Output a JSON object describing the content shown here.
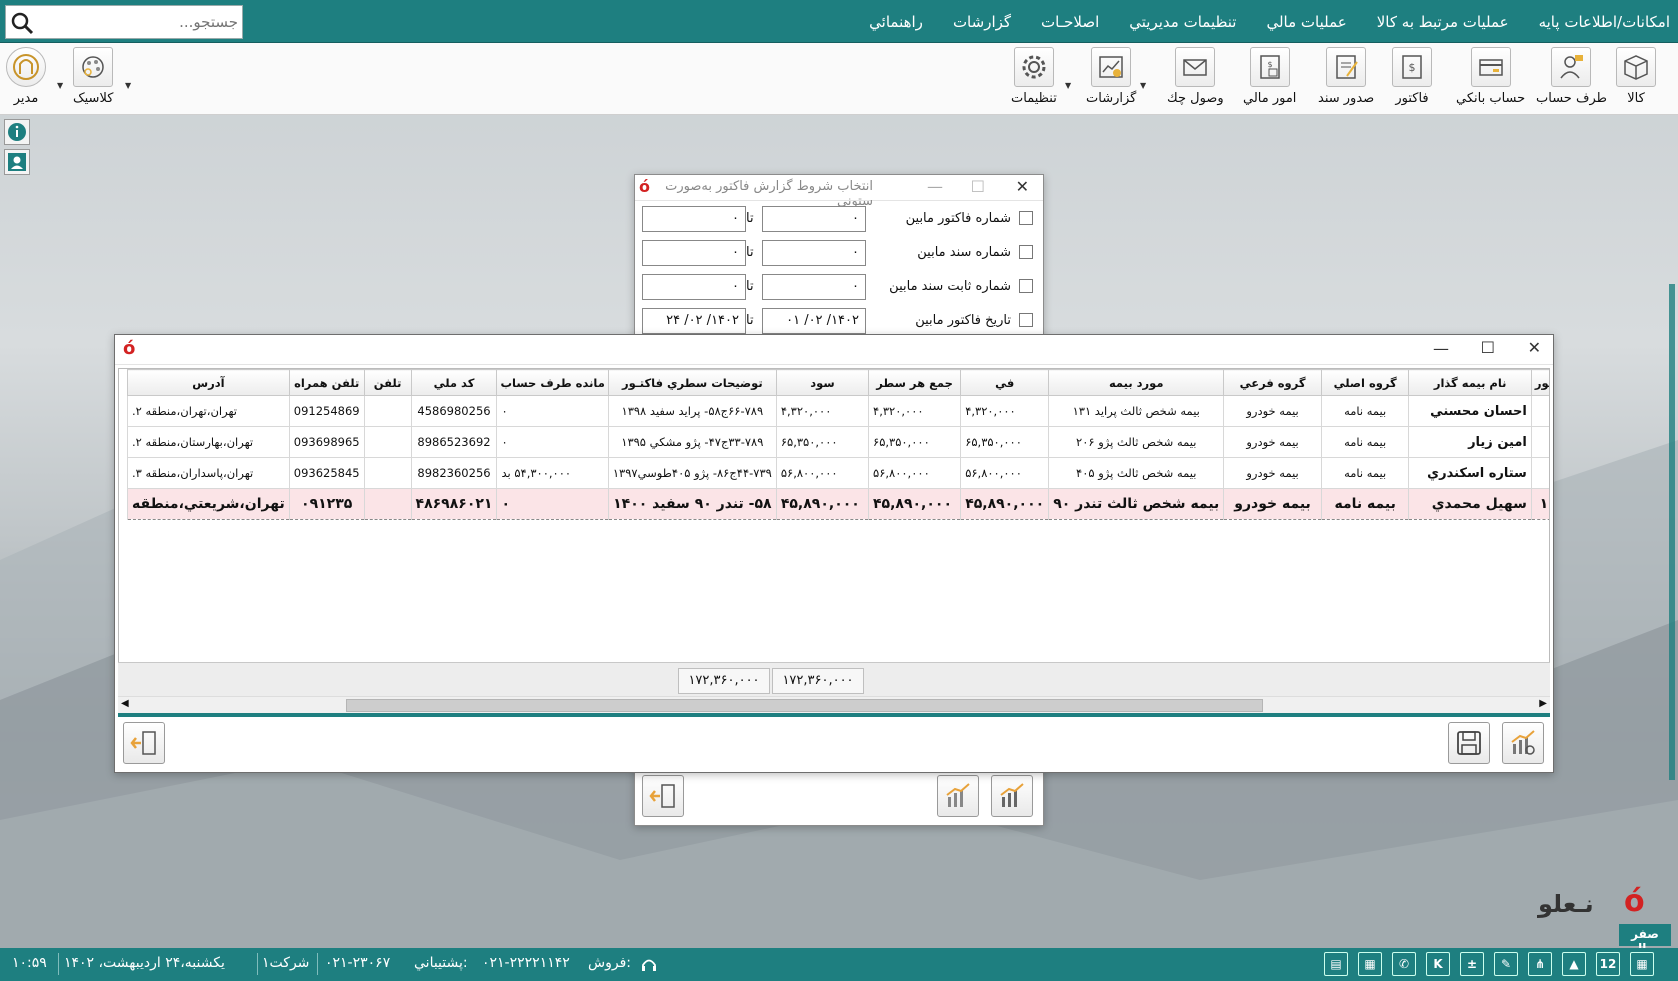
{
  "menu": {
    "items": [
      "امکانات/اطلاعات پايه",
      "عمليات مرتبط به کالا",
      "عمليات مالي",
      "تنظيمات مديريتي",
      "اصلاحـات",
      "گزارشات",
      "راهنمائي"
    ],
    "search_placeholder": "جستجو..."
  },
  "toolbar": {
    "kala": "کالا",
    "taraf": "طرف حساب",
    "bank": "حساب بانکي",
    "factor": "فاکتور",
    "sanad": "صدور سند",
    "mali": "امور مالي",
    "check": "وصول چك",
    "reports": "گزارشات",
    "settings": "تنظيمات",
    "classic": "کلاسيک",
    "manager": "مدير"
  },
  "filter_dialog": {
    "title": "انتخاب شروط گزارش فاکتور به‌صورت ستوني",
    "to_label": "تا",
    "rows": [
      {
        "label": "شماره فاكتور مابين",
        "from": "۰",
        "to": "۰"
      },
      {
        "label": "شماره سند مابين",
        "from": "۰",
        "to": "۰"
      },
      {
        "label": "شماره ثابت سند مابين",
        "from": "۰",
        "to": "۰"
      },
      {
        "label": "تاريخ فاكتور مابين",
        "from": "۱۴۰۲/ ۰۲/ ۰۱",
        "to": "۱۴۰۲/ ۰۲/ ۲۴"
      }
    ]
  },
  "grid": {
    "columns": [
      "تور",
      "نام بيمه گذار",
      "گروه اصلي",
      "گروه فرعي",
      "مورد بيمه",
      "في",
      "جمع هر سطر",
      "سود",
      "توضيحات سطري فاكتـور",
      "مانده طرف حساب",
      "كد ملي",
      "تلفن",
      "تلفن همراه",
      "آدرس"
    ],
    "rows": [
      [
        "",
        "احسان محسني",
        "بيمه نامه",
        "بيمه خودرو",
        "بيمه شخص ثالث پرايد ۱۳۱",
        "۴,۳۲۰,۰۰۰",
        "۴,۳۲۰,۰۰۰",
        "۴,۳۲۰,۰۰۰",
        "۶۶-۷۸۹ج۵۸- پرايد سفيد ۱۳۹۸",
        "۰",
        "4586980256",
        "",
        "091254869",
        "تهران،تهران،منطقه ۲."
      ],
      [
        "",
        "امين زيار",
        "بيمه نامه",
        "بيمه خودرو",
        "بيمه شخص ثالث پژو ۲۰۶",
        "۶۵,۳۵۰,۰۰۰",
        "۶۵,۳۵۰,۰۰۰",
        "۶۵,۳۵۰,۰۰۰",
        "۳۳-۷۸۹ج۴۷- پژو مشكي ۱۳۹۵",
        "۰",
        "8986523692",
        "",
        "093698965",
        "تهران،بهارستان،منطقه ۲."
      ],
      [
        "",
        "ستاره اسکندري",
        "بيمه نامه",
        "بيمه خودرو",
        "بيمه شخص ثالث پژو ۴۰۵",
        "۵۶,۸۰۰,۰۰۰",
        "۵۶,۸۰۰,۰۰۰",
        "۵۶,۸۰۰,۰۰۰",
        "۴۴-۷۳۹ج۸۶- پژو ۴۰۵طوسي۱۳۹۷",
        "۵۴,۳۰۰,۰۰۰ بد",
        "8982360256",
        "",
        "093625845",
        "تهران،پاسداران،منطقه ۳."
      ],
      [
        "۱",
        "سهيل محمدي",
        "بيمه نامه",
        "بيمه خودرو",
        "بيمه شخص ثالث تندر ۹۰",
        "۴۵,۸۹۰,۰۰۰",
        "۴۵,۸۹۰,۰۰۰",
        "۴۵,۸۹۰,۰۰۰",
        "۵۸- تندر ۹۰ سفيد ۱۴۰۰",
        "۰",
        "۴۸۶۹۸۶۰۲۱",
        "",
        "۰۹۱۲۳۵",
        "تهران،شريعتي،منطقه"
      ]
    ],
    "totals": {
      "sum_row": "۱۷۲,۳۶۰,۰۰۰",
      "profit": "۱۷۲,۳۶۰,۰۰۰"
    }
  },
  "brand": {
    "logo_text": "نـعلو",
    "currency": "صفر ريال"
  },
  "status": {
    "sales_label": "فروش:",
    "sales_phone": "۰۲۱-۲۲۲۲۱۱۴۲",
    "support_label": "پشتيباني:",
    "support_phone": "۰۲۱-۲۳۰۶۷",
    "company": "شركت۱",
    "date": "يكشنبه،۲۴ ارديبهشت، ۱۴۰۲",
    "time": "۱۰:۵۹"
  },
  "colors": {
    "accent": "#1e7f80",
    "selected_row": "#fbe4e7",
    "logo_red": "#d32222"
  }
}
